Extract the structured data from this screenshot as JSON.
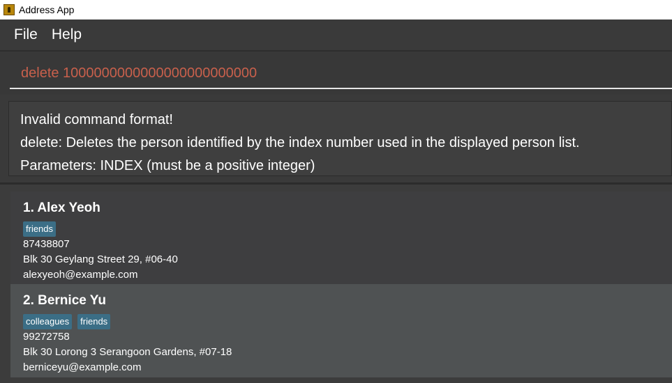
{
  "window": {
    "title": "Address App"
  },
  "menu": {
    "items": [
      "File",
      "Help"
    ]
  },
  "command": {
    "value": "delete 1000000000000000000000000"
  },
  "result": {
    "lines": [
      "Invalid command format!",
      "delete: Deletes the person identified by the index number used in the displayed person list.",
      "Parameters: INDEX (must be a positive integer)"
    ]
  },
  "persons": [
    {
      "index_name": "1.  Alex Yeoh",
      "tags": [
        "friends"
      ],
      "phone": "87438807",
      "address": "Blk 30 Geylang Street 29, #06-40",
      "email": "alexyeoh@example.com"
    },
    {
      "index_name": "2.  Bernice Yu",
      "tags": [
        "colleagues",
        "friends"
      ],
      "phone": "99272758",
      "address": "Blk 30 Lorong 3 Serangoon Gardens, #07-18",
      "email": "berniceyu@example.com"
    }
  ],
  "colors": {
    "command_text": "#c8604c",
    "tag_bg": "#3b6e86",
    "selected_card_bg": "#4f5253"
  },
  "icons": {
    "app": "address-book-icon"
  }
}
